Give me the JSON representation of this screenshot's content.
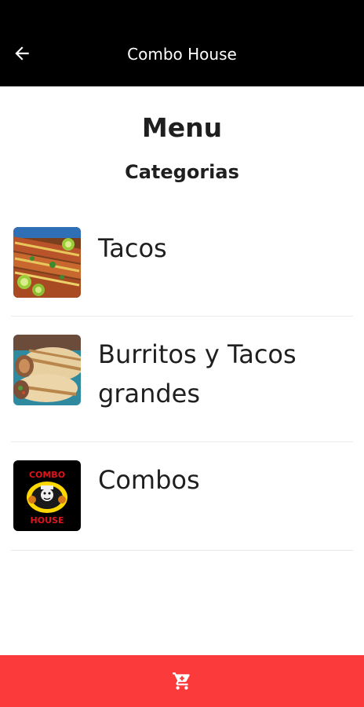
{
  "header": {
    "title": "Combo House",
    "back_icon": "arrow-left-icon"
  },
  "main": {
    "title": "Menu",
    "section_title": "Categorias",
    "categories": [
      {
        "label": "Tacos",
        "thumbnail_icon": "tacos-photo"
      },
      {
        "label": "Burritos y Tacos grandes",
        "thumbnail_icon": "burrito-photo"
      },
      {
        "label": "Combos",
        "thumbnail_icon": "combo-house-logo"
      }
    ]
  },
  "footer": {
    "cart_icon": "cart-icon"
  },
  "colors": {
    "header_bg": "#000000",
    "cart_bar_bg": "#fb3b3b",
    "text": "#1f1f1f",
    "logo_red": "#e0141b",
    "logo_yellow": "#ffd800"
  }
}
